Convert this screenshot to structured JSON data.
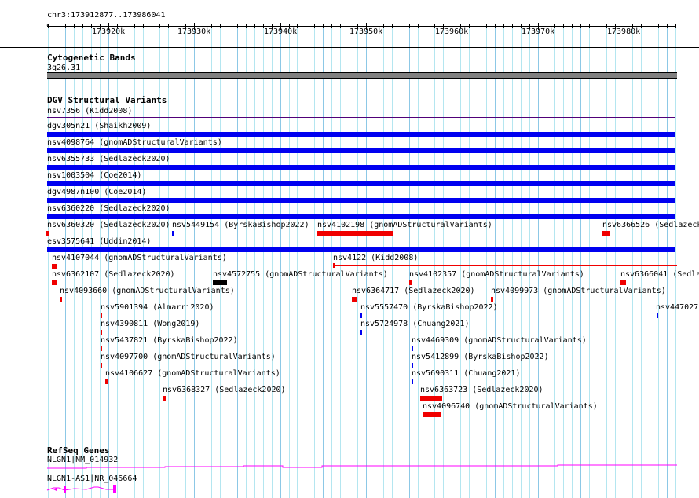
{
  "ruler": {
    "region": "chr3:173912877..173986041",
    "start": 173912877,
    "end": 173986041,
    "labels": [
      "173920k",
      "173930k",
      "173940k",
      "173950k",
      "173960k",
      "173970k",
      "173980k"
    ]
  },
  "cytoband": {
    "title": "Cytogenetic Bands",
    "band": "3q26.31"
  },
  "dgv": {
    "title": "DGV Structural Variants",
    "features": [
      "nsv7356 (Kidd2008)",
      "dgv305n21 (Shaikh2009)",
      "nsv4098764 (gnomADStructuralVariants)",
      "nsv6355733 (Sedlazeck2020)",
      "nsv1003504 (Coe2014)",
      "dgv4987n100 (Coe2014)",
      "nsv6360220 (Sedlazeck2020)",
      "nsv6360320 (Sedlazeck2020)",
      "nsv5449154 (ByrskaBishop2022)",
      "nsv4102198 (gnomADStructuralVariants)",
      "nsv6366526 (Sedlazeck",
      "esv3575641 (Uddin2014)",
      "nsv4107044 (gnomADStructuralVariants)",
      "nsv4122 (Kidd2008)",
      "nsv6362107 (Sedlazeck2020)",
      "nsv4572755 (gnomADStructuralVariants)",
      "nsv4102357 (gnomADStructuralVariants)",
      "nsv6366041 (Sedla",
      "nsv4093660 (gnomADStructuralVariants)",
      "nsv6364717 (Sedlazeck2020)",
      "nsv4099973 (gnomADStructuralVariants)",
      "nsv5901394 (Almarri2020)",
      "nsv5557470 (ByrskaBishop2022)",
      "nsv447027",
      "nsv4390811 (Wong2019)",
      "nsv5724978 (Chuang2021)",
      "nsv5437821 (ByrskaBishop2022)",
      "nsv4469309 (gnomADStructuralVariants)",
      "nsv4097700 (gnomADStructuralVariants)",
      "nsv5412899 (ByrskaBishop2022)",
      "nsv4106627 (gnomADStructuralVariants)",
      "nsv5690311 (Chuang2021)",
      "nsv6368327 (Sedlazeck2020)",
      "nsv6363723 (Sedlazeck2020)",
      "nsv4096740 (gnomADStructuralVariants)"
    ]
  },
  "refseq": {
    "title": "RefSeq Genes",
    "genes": [
      "NLGN1|NM_014932",
      "NLGN1-AS1|NR_046664"
    ]
  },
  "colors": {
    "loss": "#f00000",
    "gain": "#0000f0",
    "gene": "#ff00ff",
    "grid": "#b4e6f0",
    "grid_major": "#8cc8e6"
  }
}
